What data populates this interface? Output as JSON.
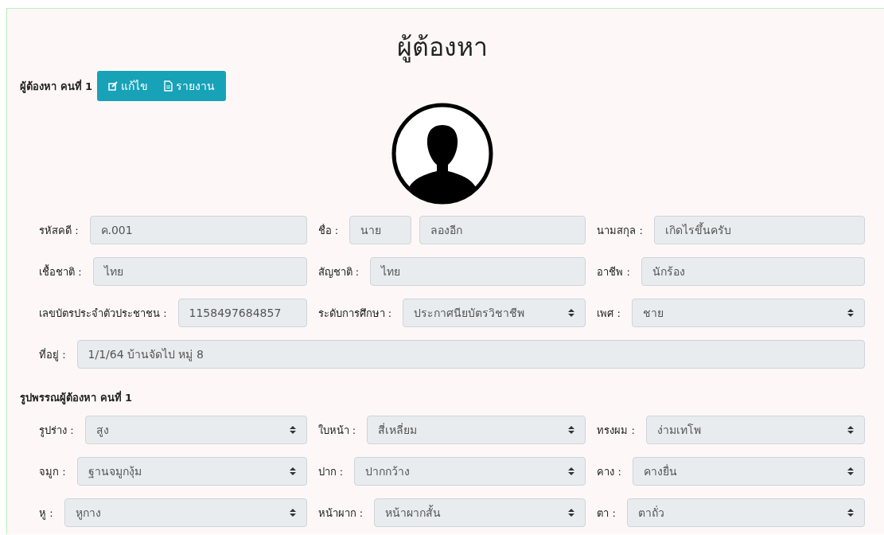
{
  "title": "ผู้ต้องหา",
  "suspect": {
    "heading": "ผู้ต้องหา คนที่ 1",
    "buttons": [
      {
        "kind": "edit",
        "label": "แก้ไข"
      },
      {
        "kind": "report",
        "label": "รายงาน"
      }
    ]
  },
  "info_rows": [
    [
      {
        "label": "รหัสคดี :",
        "kind": "text",
        "values": [
          "ค.001"
        ]
      },
      {
        "label": "ชื่อ :",
        "kind": "text",
        "values": [
          "นาย",
          "ลองอีก"
        ]
      },
      {
        "label": "นามสกุล :",
        "kind": "text",
        "values": [
          "เกิดไรขึ้นครับ"
        ]
      }
    ],
    [
      {
        "label": "เชื้อชาติ :",
        "kind": "text",
        "values": [
          "ไทย"
        ]
      },
      {
        "label": "สัญชาติ :",
        "kind": "text",
        "values": [
          "ไทย"
        ]
      },
      {
        "label": "อาชีพ :",
        "kind": "text",
        "values": [
          "นักร้อง"
        ]
      }
    ],
    [
      {
        "label": "เลขบัตรประจำตัวประชาชน :",
        "kind": "text",
        "values": [
          "1158497684857"
        ]
      },
      {
        "label": "ระดับการศึกษา :",
        "kind": "select",
        "values": [
          "ประกาศนียบัตรวิชาชีพ"
        ]
      },
      {
        "label": "เพศ :",
        "kind": "select",
        "values": [
          "ชาย"
        ]
      }
    ],
    [
      {
        "label": "ที่อยู่ :",
        "kind": "text",
        "values": [
          "1/1/64 บ้านจัดไป หมู่ 8"
        ]
      }
    ]
  ],
  "appearance": {
    "heading": "รูปพรรณผู้ต้องหา คนที่ 1",
    "rows": [
      [
        {
          "label": "รูปร่าง :",
          "kind": "select",
          "values": [
            "สูง"
          ]
        },
        {
          "label": "ใบหน้า :",
          "kind": "select",
          "values": [
            "สี่เหลี่ยม"
          ]
        },
        {
          "label": "ทรงผม :",
          "kind": "select",
          "values": [
            "ง่ามเทโพ"
          ]
        }
      ],
      [
        {
          "label": "จมูก :",
          "kind": "select",
          "values": [
            "ฐานจมูกงุ้ม"
          ]
        },
        {
          "label": "ปาก :",
          "kind": "select",
          "values": [
            "ปากกว้าง"
          ]
        },
        {
          "label": "คาง :",
          "kind": "select",
          "values": [
            "คางยื่น"
          ]
        }
      ],
      [
        {
          "label": "หู :",
          "kind": "select",
          "values": [
            "หูกาง"
          ]
        },
        {
          "label": "หน้าผาก :",
          "kind": "select",
          "values": [
            "หน้าผากสั้น"
          ]
        },
        {
          "label": "ตา :",
          "kind": "select",
          "values": [
            "ตาถั่ว"
          ]
        }
      ]
    ]
  }
}
